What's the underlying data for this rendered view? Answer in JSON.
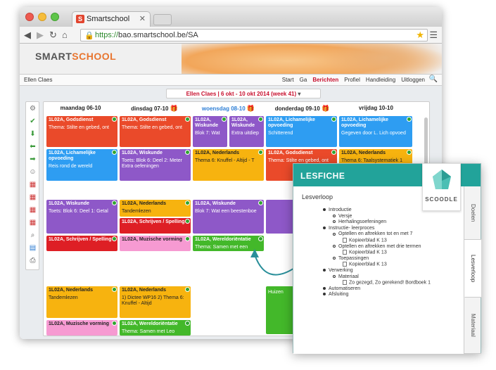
{
  "browser": {
    "tab_title": "Smartschool",
    "tab_favicon": "S",
    "url_scheme": "https://",
    "url_rest": "bao.smartschool.be/SA"
  },
  "header": {
    "logo_part1": "SMART",
    "logo_part2": "SCHOOL",
    "user": "Ellen Claes",
    "nav": [
      "Start",
      "Ga",
      "Berichten",
      "Profiel",
      "Handleiding",
      "Uitloggen"
    ],
    "active_nav": "Berichten"
  },
  "week": {
    "label": "Ellen Claes",
    "range": "6 okt - 10 okt 2014 (week 41)"
  },
  "days": [
    {
      "label": "maandag 06-10",
      "today": false,
      "gift": false
    },
    {
      "label": "dinsdag 07-10",
      "today": false,
      "gift": true
    },
    {
      "label": "woensdag 08-10",
      "today": true,
      "gift": true
    },
    {
      "label": "donderdag 09-10",
      "today": false,
      "gift": true
    },
    {
      "label": "vrijdag 10-10",
      "today": false,
      "gift": false
    }
  ],
  "cards": [
    {
      "title": "1L02A, Godsdienst",
      "sub": "Thema: Stilte en gebed, ont",
      "color": "red"
    },
    {
      "title": "1L02A, Godsdienst",
      "sub": "Thema: Stilte en gebed, ont",
      "color": "red"
    },
    {
      "title": "1L02A, Wiskunde",
      "sub": "Blok 7: Wat",
      "color": "purple"
    },
    {
      "title": "1L02A, Wiskunde",
      "sub": "Extra uitdiep",
      "color": "purple"
    },
    {
      "title": "1L02A, Lichamelijke opvoeding",
      "sub": "Schitterend",
      "color": "blue"
    },
    {
      "title": "1L02A, Lichamelijke opvoeding",
      "sub": "Gegeven door L. Lich opvoed",
      "color": "blue"
    },
    {
      "title": "1L02A, Lichamelijke opvoeding",
      "sub": "Reis rond de wereld",
      "color": "blue"
    },
    {
      "title": "1L02A, Wiskunde",
      "sub": "Toets: Blok 6: Deel 2: Meter Extra oefeningen",
      "color": "purple"
    },
    {
      "title": "1L02A, Nederlands",
      "sub": "Thema 6: Knuffel - Altijd - T",
      "color": "orange"
    },
    {
      "title": "1L02A, Godsdienst",
      "sub": "Thema: Stilte en gebed, ont",
      "color": "red"
    },
    {
      "title": "1L02A, Nederlands",
      "sub": "Thema 6: Taalsystematiek 1",
      "color": "orange"
    },
    {
      "title": "1L02A, Wiskunde",
      "sub": "Toets: Blok 6: Deel 1: Getal",
      "color": "purple"
    },
    {
      "title": "1L02A, Nederlands",
      "sub": "Tandemlezen",
      "color": "orange"
    },
    {
      "title": "1L02A, Schrijven / Spelling",
      "sub": "",
      "color": "crimson"
    },
    {
      "title": "1L02A, Muzische vorming",
      "sub": "",
      "color": "pink"
    },
    {
      "title": "1L02A, Wiskunde",
      "sub": "Blok 7: Wat een beestenboe",
      "color": "purple"
    },
    {
      "title": "1L02A, Wereldoriëntatie",
      "sub": "Thema: Samen met een",
      "color": "green"
    },
    {
      "title": "1L02A, Schrijven / Spelling",
      "sub": "",
      "color": "crimson"
    },
    {
      "title": "1L02A, Nederlands",
      "sub": "Tandemlezen",
      "color": "orange"
    },
    {
      "title": "1L02A, Nederlands",
      "sub": "1) Dictee WP16 2) Thema 6: Knuffel - Altijd",
      "color": "orange"
    },
    {
      "title": "1L02A, Muzische vorming",
      "sub": "",
      "color": "pink"
    },
    {
      "title": "1L02A, Wereldoriëntatie",
      "sub": "Thema: Samen met Leo",
      "color": "green"
    },
    {
      "title": "Huizen",
      "sub": "",
      "color": "green"
    }
  ],
  "lesfiche": {
    "title": "LESFICHE",
    "section": "Lesverloop",
    "brand": "SCOODLE",
    "tabs": [
      "Doelen",
      "Lesverloop",
      "Materiaal"
    ],
    "tree": [
      {
        "level": 0,
        "type": "bullet",
        "text": "Introductie"
      },
      {
        "level": 1,
        "type": "circle",
        "text": "Versje"
      },
      {
        "level": 1,
        "type": "circle",
        "text": "Herhalingsoefeningen"
      },
      {
        "level": 0,
        "type": "bullet",
        "text": "Instructie- leerproces"
      },
      {
        "level": 1,
        "type": "circle",
        "text": "Optellen en aftrekken tot en met 7"
      },
      {
        "level": 2,
        "type": "doc",
        "text": "Kopieerblad K 13"
      },
      {
        "level": 1,
        "type": "circle",
        "text": "Optellen en aftrekken met drie termen"
      },
      {
        "level": 2,
        "type": "doc",
        "text": "Kopieerblad K 13"
      },
      {
        "level": 1,
        "type": "circle",
        "text": "Toepassingen"
      },
      {
        "level": 2,
        "type": "doc",
        "text": "Kopieerblad K 13"
      },
      {
        "level": 0,
        "type": "bullet",
        "text": "Verwerking"
      },
      {
        "level": 1,
        "type": "circle",
        "text": "Materiaal"
      },
      {
        "level": 2,
        "type": "doc",
        "text": "Zo gezegd, Zo gerekend! Bordboek 1"
      },
      {
        "level": 0,
        "type": "bullet",
        "text": "Automatiseren"
      },
      {
        "level": 0,
        "type": "bullet",
        "text": "Afsluiting"
      }
    ]
  },
  "colors": {
    "red": "#ea4a2a",
    "blue": "#2e9df2",
    "purple": "#8e58c8",
    "orange": "#f7b30f",
    "crimson": "#de1f25",
    "pink": "#f69ad2",
    "green": "#43b82a",
    "accent": "#22a39a"
  },
  "icons": [
    "gear-icon",
    "check-icon",
    "arrow-down-icon",
    "arrow-left-icon",
    "arrow-right-icon",
    "user-icon",
    "calendar-icon",
    "calendar-icon",
    "calendar-icon",
    "calendar-icon",
    "search-icon",
    "chart-icon",
    "printer-icon"
  ]
}
